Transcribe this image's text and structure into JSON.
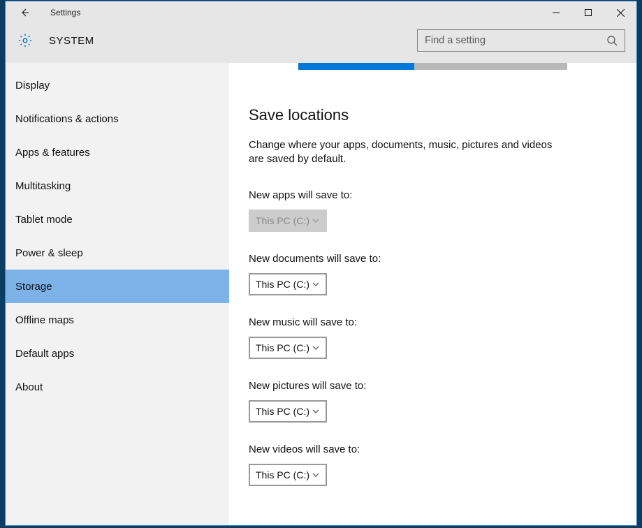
{
  "window": {
    "title": "Settings",
    "section": "SYSTEM"
  },
  "search": {
    "placeholder": "Find a setting"
  },
  "sidebar": {
    "items": [
      {
        "label": "Display",
        "selected": false
      },
      {
        "label": "Notifications & actions",
        "selected": false
      },
      {
        "label": "Apps & features",
        "selected": false
      },
      {
        "label": "Multitasking",
        "selected": false
      },
      {
        "label": "Tablet mode",
        "selected": false
      },
      {
        "label": "Power & sleep",
        "selected": false
      },
      {
        "label": "Storage",
        "selected": true
      },
      {
        "label": "Offline maps",
        "selected": false
      },
      {
        "label": "Default apps",
        "selected": false
      },
      {
        "label": "About",
        "selected": false
      }
    ]
  },
  "content": {
    "heading": "Save locations",
    "description": "Change where your apps, documents, music, pictures and videos are saved by default.",
    "progress_percent": 43,
    "fields": [
      {
        "label": "New apps will save to:",
        "value": "This PC (C:)",
        "disabled": true
      },
      {
        "label": "New documents will save to:",
        "value": "This PC (C:)",
        "disabled": false
      },
      {
        "label": "New music will save to:",
        "value": "This PC (C:)",
        "disabled": false
      },
      {
        "label": "New pictures will save to:",
        "value": "This PC (C:)",
        "disabled": false
      },
      {
        "label": "New videos will save to:",
        "value": "This PC (C:)",
        "disabled": false
      }
    ]
  }
}
